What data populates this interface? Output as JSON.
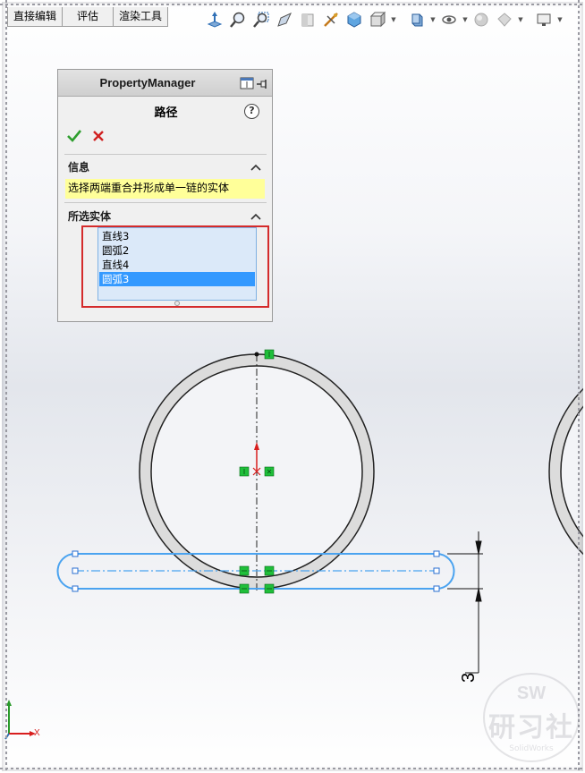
{
  "tabs": [
    {
      "label": "直接编辑"
    },
    {
      "label": "评估"
    },
    {
      "label": "渲染工具"
    }
  ],
  "heads_up_toolbar": {
    "icons": [
      "view-orientation-icon",
      "zoom-to-fit-icon",
      "zoom-to-area-icon",
      "previous-view-icon",
      "section-view-icon",
      "dynamic-annotation-icon",
      "view-type-icon",
      "display-style-icon",
      "hide-show-items-icon",
      "edit-appearance-icon",
      "apply-scene-icon",
      "view-settings-icon",
      "display-monitor-icon"
    ]
  },
  "property_manager": {
    "header_title": "PropertyManager",
    "feature_title": "路径",
    "help_label": "?",
    "info_section": {
      "title": "信息",
      "message": "选择两端重合并形成单一链的实体"
    },
    "selected_entities_section": {
      "title": "所选实体",
      "items": [
        {
          "label": "直线3",
          "selected": false
        },
        {
          "label": "圆弧2",
          "selected": false
        },
        {
          "label": "直线4",
          "selected": false
        },
        {
          "label": "圆弧3",
          "selected": true
        }
      ]
    }
  },
  "drawing": {
    "dimension_value": "3",
    "colors": {
      "ring_fill": "#dcdcdc",
      "ring_stroke": "#222222",
      "selected_sketch": "#4aa3f0",
      "relation_marker": "#1fbf3a",
      "origin_arrow": "#d81e1e"
    }
  },
  "triad": {
    "x_label": "X"
  },
  "watermark": {
    "top": "SW",
    "main": "研习社",
    "sub": "SolidWorks"
  }
}
